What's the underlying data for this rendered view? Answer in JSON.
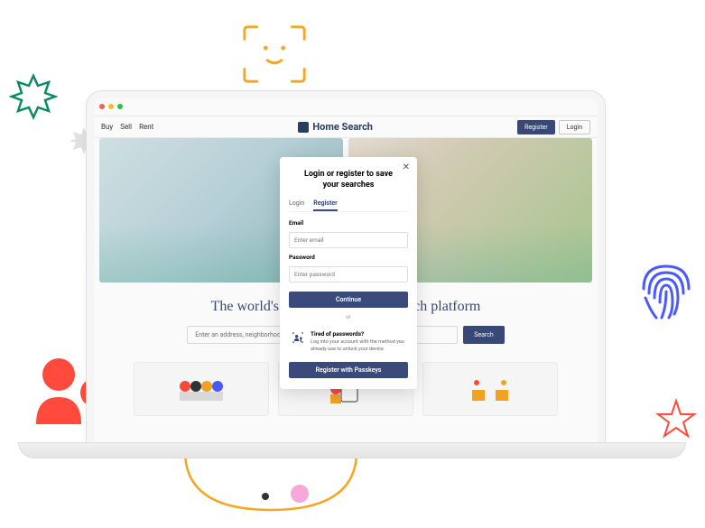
{
  "nav": {
    "buy": "Buy",
    "sell": "Sell",
    "rent": "Rent",
    "brand": "Home Search",
    "register": "Register",
    "login": "Login"
  },
  "tagline": "The world's leading real estate search platform",
  "search": {
    "placeholder": "Enter an address, neighborhood",
    "button": "Search"
  },
  "modal": {
    "title": "Login or register to save your searches",
    "tabs": {
      "login": "Login",
      "register": "Register"
    },
    "email_label": "Email",
    "email_placeholder": "Enter email",
    "password_label": "Password",
    "password_placeholder": "Enter password",
    "continue": "Continue",
    "or": "or",
    "passkey_title": "Tired of passwords?",
    "passkey_desc": "Log into your account with the method you already use to unlock your device.",
    "passkey_button": "Register with Passkeys"
  },
  "colors": {
    "primary": "#3a4a7a",
    "accent_orange": "#f5a623",
    "accent_red": "#ff4a3d",
    "accent_green": "#0a8a5f",
    "accent_blue": "#4a5aff"
  }
}
